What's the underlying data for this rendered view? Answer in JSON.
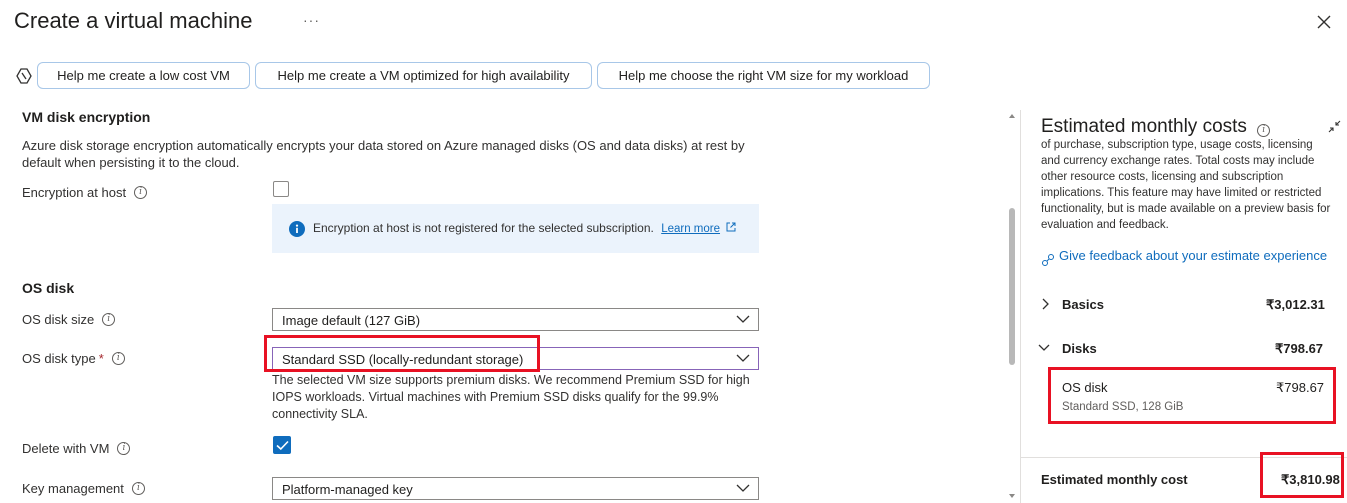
{
  "header": {
    "title": "Create a virtual machine",
    "more_label": "···"
  },
  "copilot": {
    "prompts": [
      "Help me create a low cost VM",
      "Help me create a VM optimized for high availability",
      "Help me choose the right VM size for my workload"
    ]
  },
  "encryption": {
    "heading": "VM disk encryption",
    "description": "Azure disk storage encryption automatically encrypts your data stored on Azure managed disks (OS and data disks) at rest by default when persisting it to the cloud.",
    "host_label": "Encryption at host",
    "host_checked": false,
    "info_message": "Encryption at host is not registered for the selected subscription.",
    "learn_more": "Learn more"
  },
  "os_disk": {
    "heading": "OS disk",
    "size_label": "OS disk size",
    "size_value": "Image default (127 GiB)",
    "type_label": "OS disk type",
    "type_value": "Standard SSD (locally-redundant storage)",
    "type_note": "The selected VM size supports premium disks. We recommend Premium SSD for high IOPS workloads. Virtual machines with Premium SSD disks qualify for the 99.9% connectivity SLA.",
    "delete_label": "Delete with VM",
    "delete_checked": true,
    "key_label": "Key management",
    "key_value": "Platform-managed key"
  },
  "cost_panel": {
    "title": "Estimated monthly costs",
    "text": "of purchase, subscription type, usage costs, licensing and currency exchange rates. Total costs may include other resource costs, licensing and subscription implications. This feature may have limited or restricted functionality, but is made available on a preview basis for evaluation and feedback.",
    "feedback": "Give feedback about your estimate experience",
    "basics_label": "Basics",
    "basics_cost": "₹3,012.31",
    "disks_label": "Disks",
    "disks_cost": "₹798.67",
    "os_disk_label": "OS disk",
    "os_disk_cost": "₹798.67",
    "os_disk_detail": "Standard SSD, 128 GiB",
    "total_label": "Estimated monthly cost",
    "total_cost": "₹3,810.98"
  },
  "colors": {
    "accent": "#0f6cbd",
    "highlight": "#e81123"
  }
}
